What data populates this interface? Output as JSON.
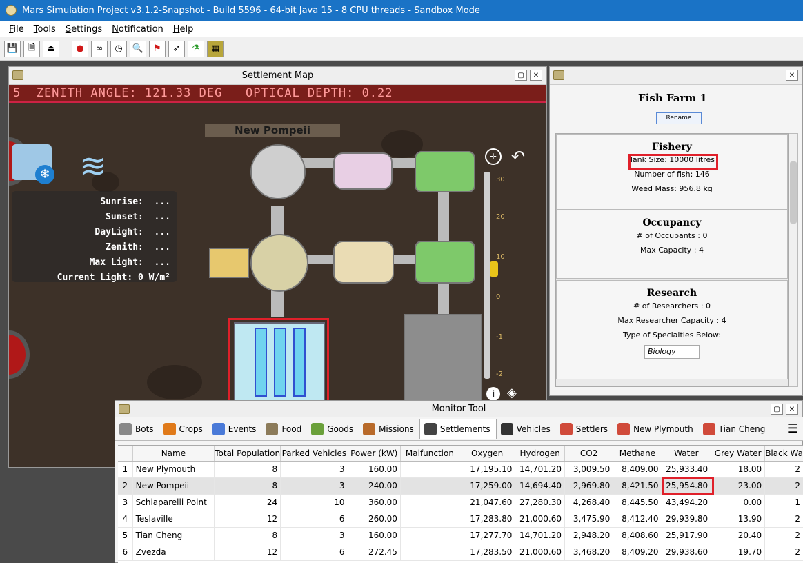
{
  "app": {
    "title": "Mars Simulation Project v3.1.2-Snapshot - Build 5596 - 64-bit Java 15 - 8 CPU threads  - Sandbox Mode"
  },
  "menu": [
    {
      "label": "File",
      "u": "F",
      "rest": "ile"
    },
    {
      "label": "Tools",
      "u": "T",
      "rest": "ools"
    },
    {
      "label": "Settings",
      "u": "S",
      "rest": "ettings"
    },
    {
      "label": "Notification",
      "u": "N",
      "rest": "otification"
    },
    {
      "label": "Help",
      "u": "H",
      "rest": "elp"
    }
  ],
  "toolbar": {
    "icons": [
      "save-icon",
      "save-as-icon",
      "exit-icon",
      "mars-icon",
      "binoculars-icon",
      "clock-icon",
      "search-doc-icon",
      "flag-icon",
      "rocket-icon",
      "flask-icon",
      "map-icon"
    ]
  },
  "map_window": {
    "title": "Settlement Map",
    "ticker": "5  ZENITH ANGLE: 121.33 DEG   OPTICAL DEPTH: 0.22",
    "settlement_name": "New Pompeii",
    "sun": {
      "sunrise": "Sunrise:  ...",
      "sunset": "Sunset:  ...",
      "daylight": "DayLight:  ...",
      "zenith": "Zenith:  ...",
      "max_light": "Max Light:  ...",
      "current_light": "Current Light: 0 W/m²"
    },
    "scale_labels": [
      "30",
      "20",
      "10",
      "0",
      "-1",
      "-2"
    ]
  },
  "info_window": {
    "title": "Fish Farm 1",
    "rename_label": "Rename",
    "fishery": {
      "heading": "Fishery",
      "tank_size": "Tank Size: 10000 litres",
      "num_fish": "Number of fish: 146",
      "weed_mass": "Weed Mass: 956.8 kg"
    },
    "occupancy": {
      "heading": "Occupancy",
      "occupants": "# of Occupants : 0",
      "max_capacity": "Max Capacity : 4"
    },
    "research": {
      "heading": "Research",
      "researchers": "# of Researchers : 0",
      "max_researchers": "Max Researcher Capacity : 4",
      "specialties_label": "Type of Specialties Below:",
      "specialty": "Biology"
    }
  },
  "monitor": {
    "title": "Monitor Tool",
    "tabs": [
      {
        "label": "Bots",
        "icon": "bot-icon",
        "color": "#888888"
      },
      {
        "label": "Crops",
        "icon": "carrot-icon",
        "color": "#e07a1a"
      },
      {
        "label": "Events",
        "icon": "flag-icon",
        "color": "#4a7ad8"
      },
      {
        "label": "Food",
        "icon": "food-icon",
        "color": "#8c7b5a"
      },
      {
        "label": "Goods",
        "icon": "basket-icon",
        "color": "#6aa03a"
      },
      {
        "label": "Missions",
        "icon": "briefcase-icon",
        "color": "#b86a2a"
      },
      {
        "label": "Settlements",
        "icon": "dome-icon",
        "color": "#444444"
      },
      {
        "label": "Vehicles",
        "icon": "vehicle-icon",
        "color": "#333333"
      },
      {
        "label": "Settlers",
        "icon": "people-icon",
        "color": "#d04a3a"
      },
      {
        "label": "New Plymouth",
        "icon": "people-icon",
        "color": "#d04a3a"
      },
      {
        "label": "Tian Cheng",
        "icon": "people-icon",
        "color": "#d04a3a"
      }
    ],
    "columns": [
      "",
      "Name",
      "Total Population",
      "Parked Vehicles",
      "Power (kW)",
      "Malfunction",
      "Oxygen",
      "Hydrogen",
      "CO2",
      "Methane",
      "Water",
      "Grey Water",
      "Black Wa"
    ],
    "rows": [
      [
        "1",
        "New Plymouth",
        "8",
        "3",
        "160.00",
        "",
        "17,195.10",
        "14,701.20",
        "3,009.50",
        "8,409.00",
        "25,933.40",
        "18.00",
        "2"
      ],
      [
        "2",
        "New Pompeii",
        "8",
        "3",
        "240.00",
        "",
        "17,259.00",
        "14,694.40",
        "2,969.80",
        "8,421.50",
        "25,954.80",
        "23.00",
        "2"
      ],
      [
        "3",
        "Schiaparelli Point",
        "24",
        "10",
        "360.00",
        "",
        "21,047.60",
        "27,280.30",
        "4,268.40",
        "8,445.50",
        "43,494.20",
        "0.00",
        "1"
      ],
      [
        "4",
        "Teslaville",
        "12",
        "6",
        "260.00",
        "",
        "17,283.80",
        "21,000.60",
        "3,475.90",
        "8,412.40",
        "29,939.80",
        "13.90",
        "2"
      ],
      [
        "5",
        "Tian Cheng",
        "8",
        "3",
        "160.00",
        "",
        "17,277.70",
        "14,701.20",
        "2,948.20",
        "8,408.60",
        "25,917.90",
        "20.40",
        "2"
      ],
      [
        "6",
        "Zvezda",
        "12",
        "6",
        "272.45",
        "",
        "17,283.50",
        "21,000.60",
        "3,468.20",
        "8,409.20",
        "29,938.60",
        "19.70",
        "2"
      ]
    ],
    "selected_row": 1
  }
}
